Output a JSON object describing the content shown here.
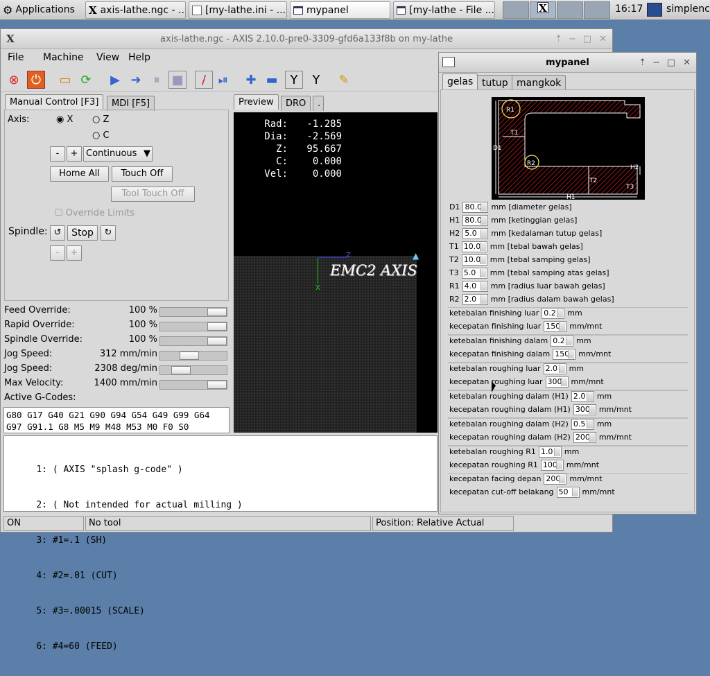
{
  "taskbar": {
    "applications": "Applications",
    "tasks": [
      "axis-lathe.ngc - ...",
      "[my-lathe.ini - ...",
      "mypanel",
      "[my-lathe - File ..."
    ],
    "clock": "16:17",
    "user": "simplenc"
  },
  "axis": {
    "title": "axis-lathe.ngc - AXIS 2.10.0-pre0-3309-gfd6a133f8b on my-lathe",
    "menu": [
      "File",
      "Machine",
      "View",
      "Help"
    ],
    "tabs": [
      "Manual Control [F3]",
      "MDI [F5]"
    ],
    "axis_label": "Axis:",
    "axes": [
      "X",
      "Z",
      "C"
    ],
    "jog_minus": "-",
    "jog_plus": "+",
    "jog_mode": "Continuous",
    "home_all": "Home All",
    "touch_off": "Touch Off",
    "tool_touch_off": "Tool Touch Off",
    "override_limits": "Override Limits",
    "spindle_label": "Spindle:",
    "spindle_stop": "Stop",
    "spindle_minus": "-",
    "spindle_plus": "+",
    "overrides": [
      {
        "label": "Feed Override:",
        "value": "100 %"
      },
      {
        "label": "Rapid Override:",
        "value": "100 %"
      },
      {
        "label": "Spindle Override:",
        "value": "100 %"
      },
      {
        "label": "Jog Speed:",
        "value": "312 mm/min"
      },
      {
        "label": "Jog Speed:",
        "value": "2308 deg/min"
      },
      {
        "label": "Max Velocity:",
        "value": "1400 mm/min"
      }
    ],
    "active_gcodes_label": "Active G-Codes:",
    "active_gcodes": [
      "G80 G17 G40 G21 G90 G94 G54 G49 G99 G64",
      "G97 G91.1 G8 M5 M9 M48 M53 M0 F0 S0"
    ],
    "preview_tabs": [
      "Preview",
      "DRO",
      "."
    ],
    "dro": [
      {
        "label": "Rad:",
        "value": "-1.285"
      },
      {
        "label": "Dia:",
        "value": "-2.569"
      },
      {
        "label": "Z:",
        "value": "95.667"
      },
      {
        "label": "C:",
        "value": "0.000"
      },
      {
        "label": "Vel:",
        "value": "0.000"
      }
    ],
    "preview_text": "EMC2 AXIS",
    "preview_axis_z": "Z",
    "preview_axis_x": "X",
    "gcode_lines": [
      {
        "n": "1:",
        "t": "( AXIS \"splash g-code\" )"
      },
      {
        "n": "2:",
        "t": "( Not intended for actual milling )"
      },
      {
        "n": "3:",
        "t": "#1=.1 (SH)"
      },
      {
        "n": "4:",
        "t": "#2=.01 (CUT)"
      },
      {
        "n": "5:",
        "t": "#3=.00015 (SCALE)"
      },
      {
        "n": "6:",
        "t": "#4=60 (FEED)"
      }
    ],
    "status": {
      "state": "ON",
      "tool": "No tool",
      "position": "Position: Relative Actual"
    }
  },
  "panel": {
    "title": "mypanel",
    "tabs": [
      "gelas",
      "tutup",
      "mangkok"
    ],
    "diagram_labels": {
      "R1": "R1",
      "R2": "R2",
      "T1": "T1",
      "T2": "T2",
      "T3": "T3",
      "D1": "D1",
      "H1": "H1",
      "H2": "H2"
    },
    "params": [
      {
        "k": "D1",
        "v": "80.0",
        "d": "mm [diameter gelas]"
      },
      {
        "k": "H1",
        "v": "80.0",
        "d": "mm [ketinggian gelas]"
      },
      {
        "k": "H2",
        "v": "5.0",
        "d": "mm [kedalaman tutup gelas]"
      },
      {
        "k": "T1",
        "v": "10.0",
        "d": "mm [tebal bawah gelas]"
      },
      {
        "k": "T2",
        "v": "10.0",
        "d": "mm [tebal samping gelas]"
      },
      {
        "k": "T3",
        "v": "5.0",
        "d": "mm [tebal samping atas gelas]"
      },
      {
        "k": "R1",
        "v": "4.0",
        "d": "mm [radius luar bawah gelas]"
      },
      {
        "k": "R2",
        "v": "2.0",
        "d": "mm [radius dalam bawah gelas]"
      }
    ],
    "settings": [
      {
        "l": "ketebalan finishing luar",
        "v": "0.2",
        "u": "mm"
      },
      {
        "l": "kecepatan finishing luar",
        "v": "150",
        "u": "mm/mnt"
      },
      {
        "l": "ketebalan finishing dalam",
        "v": "0.2",
        "u": "mm"
      },
      {
        "l": "kecepatan finishing dalam",
        "v": "150",
        "u": "mm/mnt"
      },
      {
        "l": "ketebalan roughing luar",
        "v": "2.0",
        "u": "mm"
      },
      {
        "l": "kecepatan roughing luar",
        "v": "300",
        "u": "mm/mnt"
      },
      {
        "l": "ketebalan roughing dalam (H1)",
        "v": "2.0",
        "u": "mm"
      },
      {
        "l": "kecepatan roughing dalam (H1)",
        "v": "300",
        "u": "mm/mnt"
      },
      {
        "l": "ketebalan roughing dalam (H2)",
        "v": "0.5",
        "u": "mm"
      },
      {
        "l": "kecepatan roughing dalam (H2)",
        "v": "200",
        "u": "mm/mnt"
      },
      {
        "l": "ketebalan roughing R1",
        "v": "1.0",
        "u": "mm"
      },
      {
        "l": "kecepatan roughing R1",
        "v": "100",
        "u": "mm/mnt"
      },
      {
        "l": "kecepatan facing depan",
        "v": "200",
        "u": "mm/mnt"
      },
      {
        "l": "kecepatan cut-off belakang",
        "v": "50",
        "u": "mm/mnt"
      }
    ],
    "colors": {
      "diagram_bg": "#000000",
      "hatch": "#cc1f1f",
      "outline": "#ffffff",
      "circle": "#f5e663"
    }
  }
}
